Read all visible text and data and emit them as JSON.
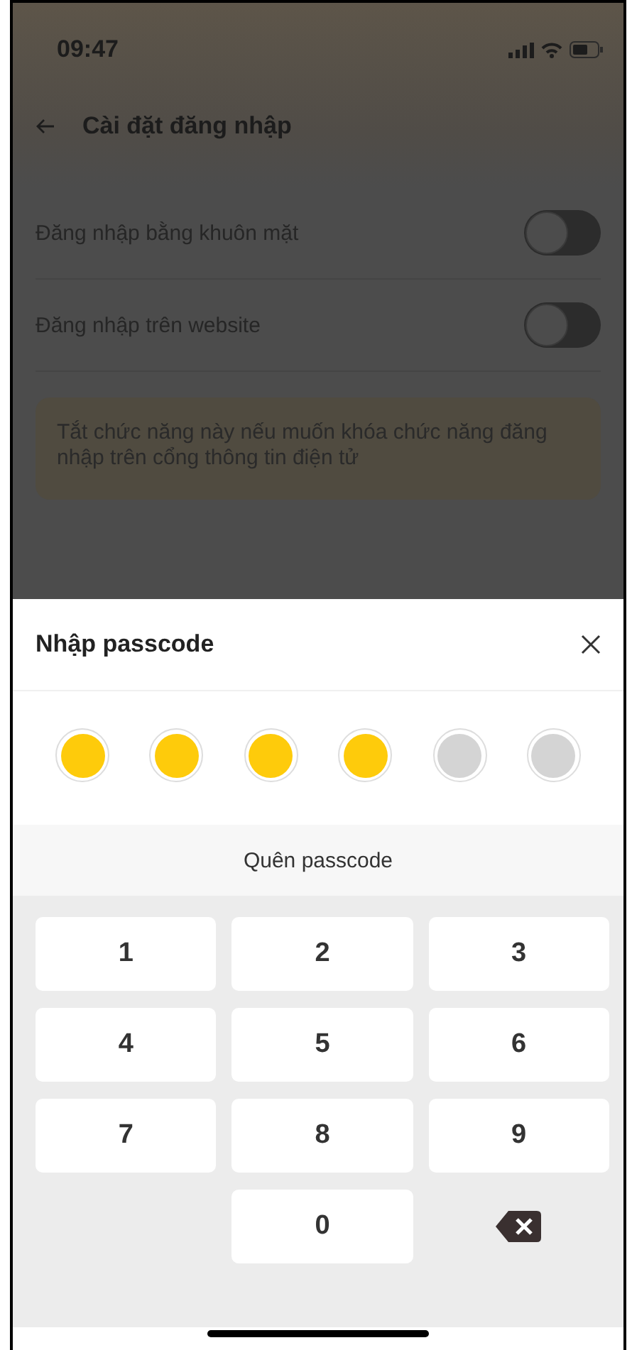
{
  "status_bar": {
    "time": "09:47"
  },
  "header": {
    "title": "Cài đặt đăng nhập"
  },
  "settings": [
    {
      "label": "Đăng nhập bằng khuôn mặt",
      "on": false
    },
    {
      "label": "Đăng nhập trên website",
      "on": false
    }
  ],
  "note": "Tắt chức năng này nếu muốn khóa chức năng đăng nhập trên cổng thông tin điện tử",
  "passcode_sheet": {
    "title": "Nhập passcode",
    "digits": [
      {
        "filled": true
      },
      {
        "filled": true
      },
      {
        "filled": true
      },
      {
        "filled": true
      },
      {
        "filled": false
      },
      {
        "filled": false
      }
    ],
    "forgot_link": "Quên passcode",
    "keys": [
      {
        "kind": "digit",
        "label": "1"
      },
      {
        "kind": "digit",
        "label": "2"
      },
      {
        "kind": "digit",
        "label": "3"
      },
      {
        "kind": "digit",
        "label": "4"
      },
      {
        "kind": "digit",
        "label": "5"
      },
      {
        "kind": "digit",
        "label": "6"
      },
      {
        "kind": "digit",
        "label": "7"
      },
      {
        "kind": "digit",
        "label": "8"
      },
      {
        "kind": "digit",
        "label": "9"
      },
      {
        "kind": "blank"
      },
      {
        "kind": "digit",
        "label": "0"
      },
      {
        "kind": "delete"
      }
    ]
  }
}
